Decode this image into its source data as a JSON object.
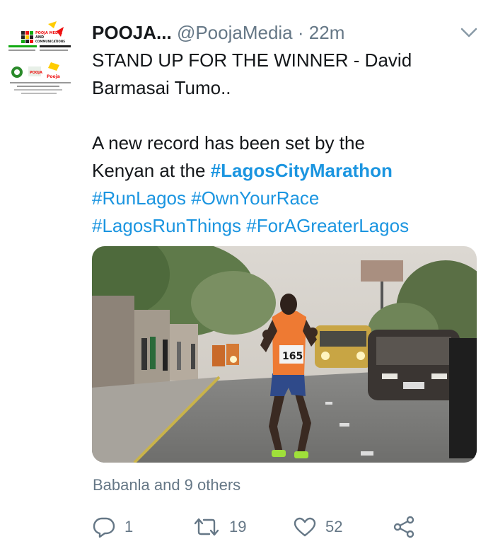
{
  "tweet": {
    "author_name": "POOJA...",
    "handle": "@PoojaMedia",
    "separator": "·",
    "time": "22m",
    "text_line1": "STAND UP FOR THE WINNER - David",
    "text_line2": "Barmasai Tumo..",
    "text_line3": "A new record has been set by the",
    "text_line4_prefix": "Kenyan at the ",
    "hashtag_main": "#LagosCityMarathon",
    "hashtags_line5": [
      "#RunLagos",
      "#OwnYourRace"
    ],
    "hashtags_line6": [
      "#LagosRunThings",
      "#ForAGreaterLagos"
    ]
  },
  "avatar": {
    "logo_text": "POOJA MEDIA AND COMMUNICATIONS"
  },
  "photo": {
    "bib_number": "165"
  },
  "social": {
    "liked_by": "Babanla and 9 others"
  },
  "actions": {
    "reply_count": "1",
    "retweet_count": "19",
    "like_count": "52"
  },
  "colors": {
    "link": "#1b95e0",
    "muted": "#657786",
    "text": "#14171a"
  }
}
